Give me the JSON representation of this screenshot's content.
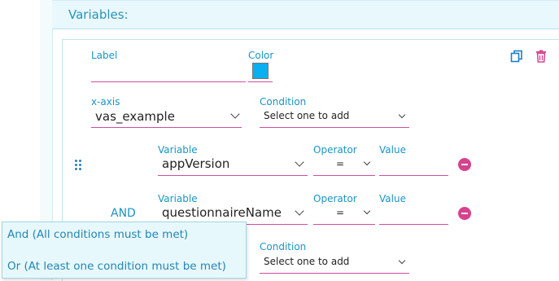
{
  "section": {
    "title": "Variables:"
  },
  "series": {
    "label_caption": "Label",
    "label_value": "",
    "color_caption": "Color",
    "color_value": "#0aafef",
    "xaxis_caption": "x-axis",
    "xaxis_value": "vas_example",
    "condition_caption": "Condition",
    "condition_placeholder": "Select one to add"
  },
  "conditions": [
    {
      "joiner": "",
      "variable_caption": "Variable",
      "variable_value": "appVersion",
      "operator_caption": "Operator",
      "operator_value": "=",
      "value_caption": "Value",
      "value_value": ""
    },
    {
      "joiner": "AND",
      "variable_caption": "Variable",
      "variable_value": "questionnaireName",
      "operator_caption": "Operator",
      "operator_value": "=",
      "value_caption": "Value",
      "value_value": ""
    }
  ],
  "bottom_condition": {
    "caption": "Condition",
    "placeholder": "Select one to add"
  },
  "joiner_dropdown": {
    "options": [
      "And (All conditions must be met)",
      "Or (At least one condition must be met)"
    ]
  },
  "icons": {
    "copy": "copy-icon",
    "delete": "trash-icon",
    "drag": "drag-handle-icon",
    "remove": "minus-circle-icon"
  },
  "colors": {
    "accent": "#1a94c4",
    "underline": "#d24c9e",
    "remove": "#d6428f",
    "swatch": "#0aafef"
  }
}
